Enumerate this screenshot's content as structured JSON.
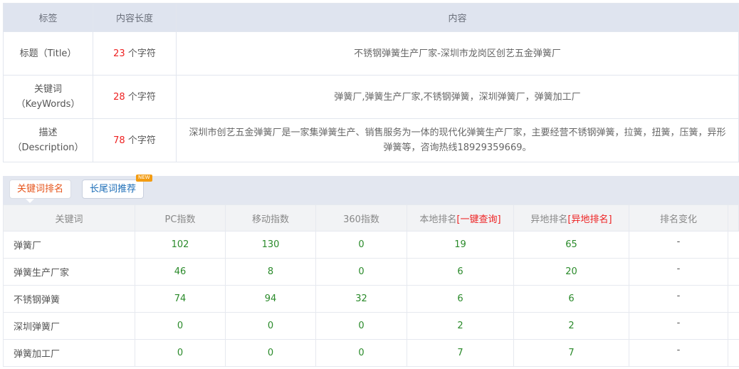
{
  "meta": {
    "headers": [
      "标签",
      "内容长度",
      "内容"
    ],
    "rows": [
      {
        "label_line1": "标题（Title）",
        "label_line2": "",
        "count": "23",
        "unit": " 个字符",
        "content": "不锈钢弹簧生产厂家-深圳市龙岗区创艺五金弹簧厂"
      },
      {
        "label_line1": "关键词",
        "label_line2": "（KeyWords）",
        "count": "28",
        "unit": " 个字符",
        "content": "弹簧厂,弹簧生产厂家,不锈钢弹簧，深圳弹簧厂，弹簧加工厂"
      },
      {
        "label_line1": "描述",
        "label_line2": "（Description）",
        "count": "78",
        "unit": " 个字符",
        "content": "深圳市创艺五金弹簧厂是一家集弹簧生产、销售服务为一体的现代化弹簧生产厂家，主要经营不锈钢弹簧，拉簧，扭簧，压簧，异形弹簧等，咨询热线18929359669。"
      }
    ]
  },
  "tabs": {
    "keyword_rank": "关键词排名",
    "longtail": "长尾词推荐",
    "new_badge": "NEW"
  },
  "rank": {
    "headers": {
      "keyword": "关键词",
      "pc": "PC指数",
      "mobile": "移动指数",
      "idx360": "360指数",
      "local_prefix": "本地排名",
      "local_link": "[一键查询]",
      "remote_prefix": "异地排名",
      "remote_link": "[异地排名]",
      "change": "排名变化"
    },
    "rows": [
      {
        "keyword": "弹簧厂",
        "pc": "102",
        "mobile": "130",
        "idx360": "0",
        "local": "19",
        "remote": "65",
        "change": "-"
      },
      {
        "keyword": "弹簧生产厂家",
        "pc": "46",
        "mobile": "8",
        "idx360": "0",
        "local": "6",
        "remote": "20",
        "change": "-"
      },
      {
        "keyword": "不锈钢弹簧",
        "pc": "74",
        "mobile": "94",
        "idx360": "32",
        "local": "6",
        "remote": "6",
        "change": "-"
      },
      {
        "keyword": "深圳弹簧厂",
        "pc": "0",
        "mobile": "0",
        "idx360": "0",
        "local": "2",
        "remote": "2",
        "change": "-"
      },
      {
        "keyword": "弹簧加工厂",
        "pc": "0",
        "mobile": "0",
        "idx360": "0",
        "local": "7",
        "remote": "7",
        "change": "-"
      }
    ]
  },
  "colors": {
    "count_red": "#e22",
    "rank_green": "#2a8a2a",
    "tab_active": "#e6541b",
    "tab_link": "#1f6fb8",
    "header_bg": "#dfe4ef"
  }
}
